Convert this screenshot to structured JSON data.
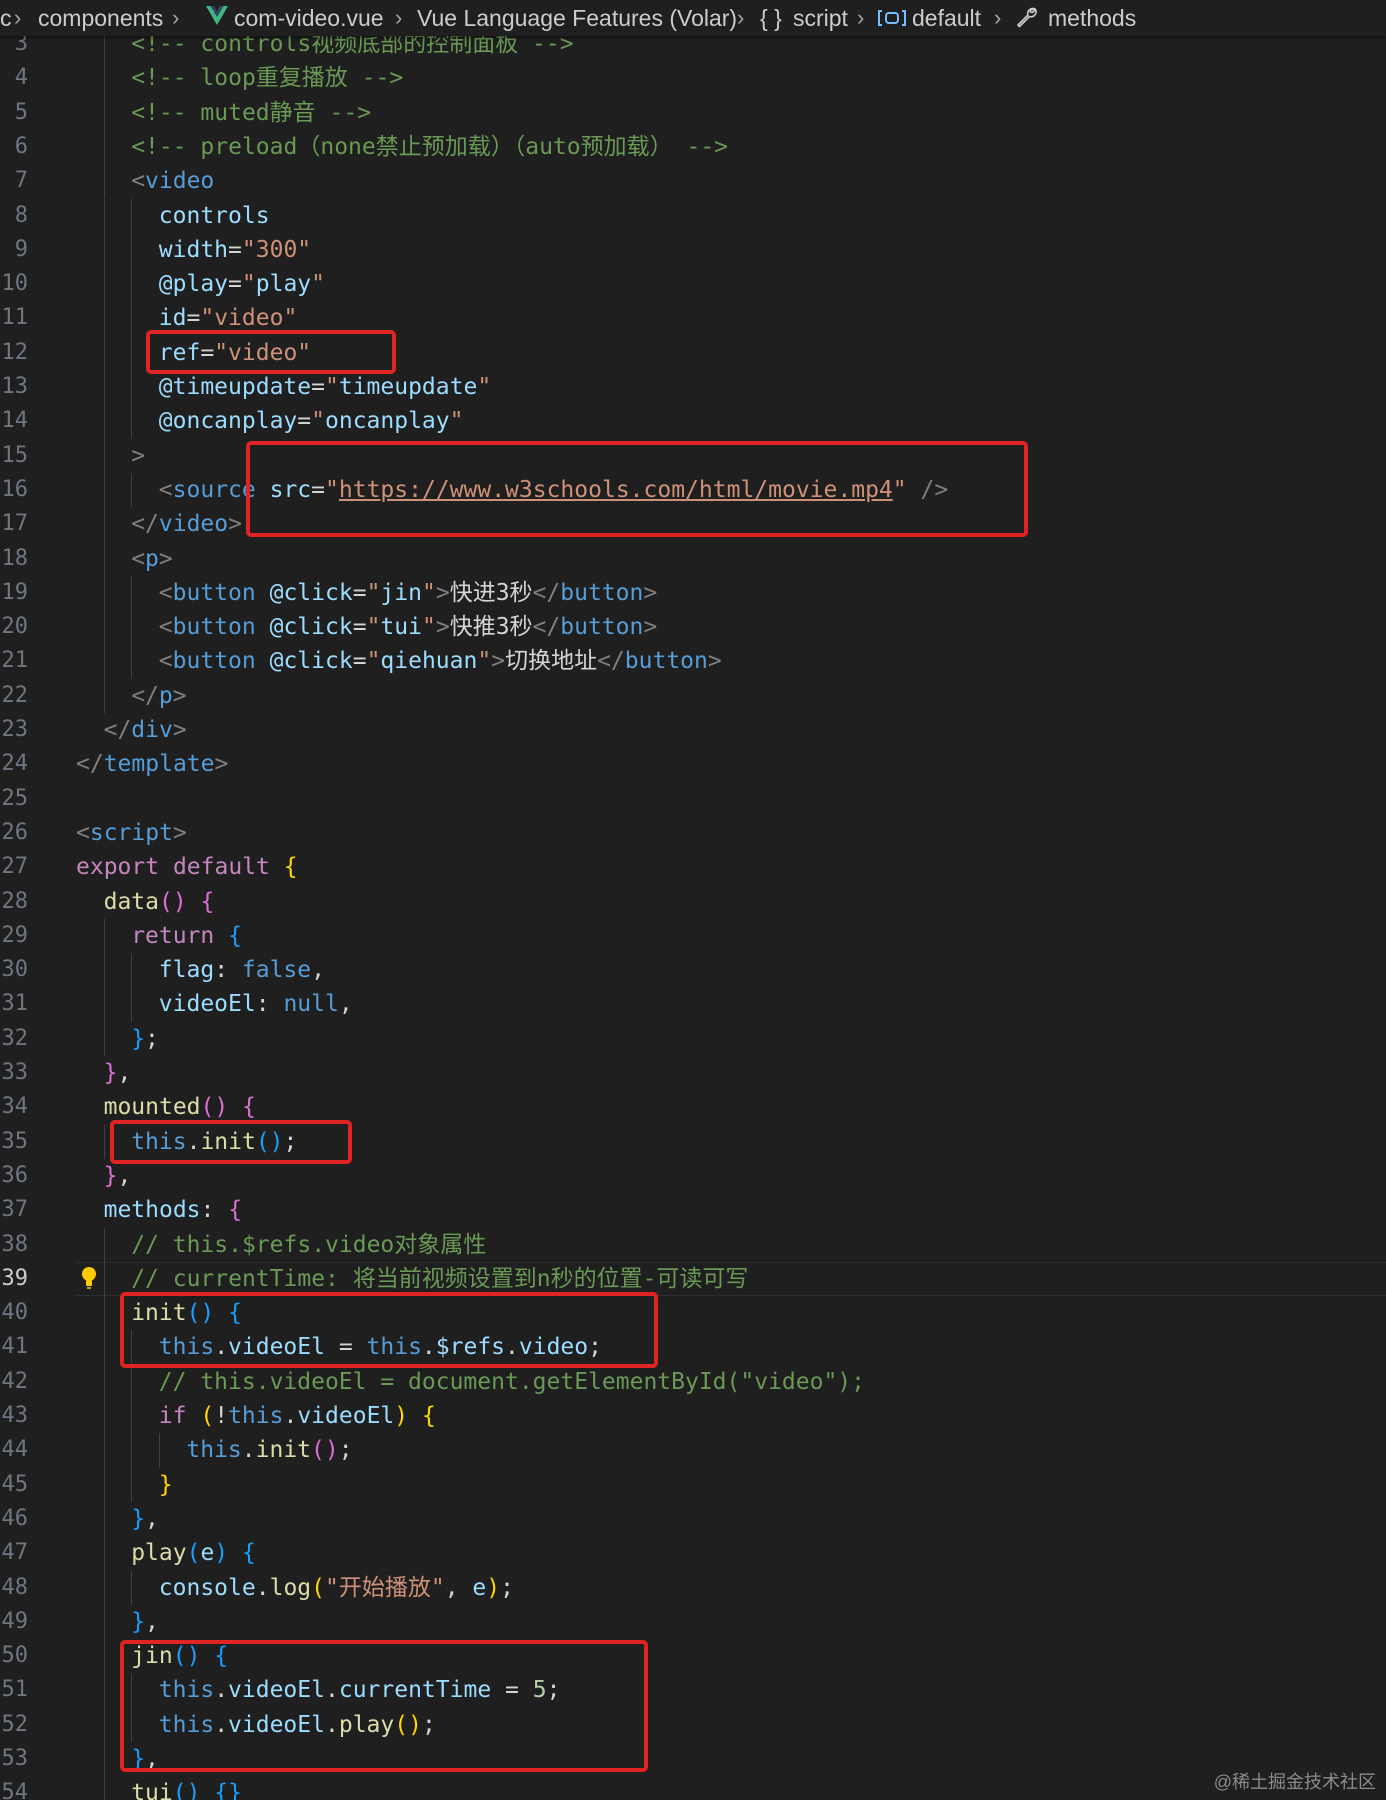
{
  "breadcrumb": {
    "items": [
      "c",
      "components",
      "com-video.vue",
      "Vue Language Features (Volar)",
      "script",
      "default",
      "methods"
    ],
    "icons": [
      "vue-icon",
      "braces-icon",
      "module-icon",
      "wrench-icon"
    ]
  },
  "editor": {
    "active_line": 39,
    "lines": [
      {
        "n": 3,
        "t": [
          [
            "c-com",
            "<!-- controls视频底部的控制面板 -->"
          ]
        ]
      },
      {
        "n": 4,
        "t": [
          [
            "c-com",
            "<!-- loop重复播放 -->"
          ]
        ]
      },
      {
        "n": 5,
        "t": [
          [
            "c-com",
            "<!-- muted静音 -->"
          ]
        ]
      },
      {
        "n": 6,
        "t": [
          [
            "c-com",
            "<!-- preload（none禁止预加载）（auto预加载） -->"
          ]
        ]
      },
      {
        "n": 7,
        "t": [
          [
            "c-br",
            "<"
          ],
          [
            "c-tag",
            "video"
          ]
        ]
      },
      {
        "n": 8,
        "t": [
          [
            "c-attr",
            "controls"
          ]
        ]
      },
      {
        "n": 9,
        "t": [
          [
            "c-attr",
            "width"
          ],
          [
            "c-txt",
            "="
          ],
          [
            "c-str",
            "\"300\""
          ]
        ]
      },
      {
        "n": 10,
        "t": [
          [
            "c-attr",
            "@play"
          ],
          [
            "c-txt",
            "="
          ],
          [
            "c-str",
            "\""
          ],
          [
            "c-var",
            "play"
          ],
          [
            "c-str",
            "\""
          ]
        ]
      },
      {
        "n": 11,
        "t": [
          [
            "c-attr",
            "id"
          ],
          [
            "c-txt",
            "="
          ],
          [
            "c-str",
            "\"video\""
          ]
        ]
      },
      {
        "n": 12,
        "t": [
          [
            "c-attr",
            "ref"
          ],
          [
            "c-txt",
            "="
          ],
          [
            "c-str",
            "\"video\""
          ]
        ]
      },
      {
        "n": 13,
        "t": [
          [
            "c-attr",
            "@timeupdate"
          ],
          [
            "c-txt",
            "="
          ],
          [
            "c-str",
            "\""
          ],
          [
            "c-var",
            "timeupdate"
          ],
          [
            "c-str",
            "\""
          ]
        ]
      },
      {
        "n": 14,
        "t": [
          [
            "c-attr",
            "@oncanplay"
          ],
          [
            "c-txt",
            "="
          ],
          [
            "c-str",
            "\""
          ],
          [
            "c-var",
            "oncanplay"
          ],
          [
            "c-str",
            "\""
          ]
        ]
      },
      {
        "n": 15,
        "t": [
          [
            "c-br",
            ">"
          ]
        ]
      },
      {
        "n": 16,
        "t": [
          [
            "c-br",
            "<"
          ],
          [
            "c-tag",
            "source"
          ],
          [
            "c-txt",
            " "
          ],
          [
            "c-attr",
            "src"
          ],
          [
            "c-txt",
            "="
          ],
          [
            "c-str",
            "\""
          ],
          [
            "c-url",
            "https://www.w3schools.com/html/movie.mp4"
          ],
          [
            "c-str",
            "\""
          ],
          [
            "c-txt",
            " "
          ],
          [
            "c-br",
            "/>"
          ]
        ]
      },
      {
        "n": 17,
        "t": [
          [
            "c-br",
            "</"
          ],
          [
            "c-tag",
            "video"
          ],
          [
            "c-br",
            ">"
          ]
        ]
      },
      {
        "n": 18,
        "t": [
          [
            "c-br",
            "<"
          ],
          [
            "c-tag",
            "p"
          ],
          [
            "c-br",
            ">"
          ]
        ]
      },
      {
        "n": 19,
        "t": [
          [
            "c-br",
            "<"
          ],
          [
            "c-tag",
            "button"
          ],
          [
            "c-txt",
            " "
          ],
          [
            "c-attr",
            "@click"
          ],
          [
            "c-txt",
            "="
          ],
          [
            "c-str",
            "\""
          ],
          [
            "c-var",
            "jin"
          ],
          [
            "c-str",
            "\""
          ],
          [
            "c-br",
            ">"
          ],
          [
            "c-txt",
            "快进3秒"
          ],
          [
            "c-br",
            "</"
          ],
          [
            "c-tag",
            "button"
          ],
          [
            "c-br",
            ">"
          ]
        ]
      },
      {
        "n": 20,
        "t": [
          [
            "c-br",
            "<"
          ],
          [
            "c-tag",
            "button"
          ],
          [
            "c-txt",
            " "
          ],
          [
            "c-attr",
            "@click"
          ],
          [
            "c-txt",
            "="
          ],
          [
            "c-str",
            "\""
          ],
          [
            "c-var",
            "tui"
          ],
          [
            "c-str",
            "\""
          ],
          [
            "c-br",
            ">"
          ],
          [
            "c-txt",
            "快推3秒"
          ],
          [
            "c-br",
            "</"
          ],
          [
            "c-tag",
            "button"
          ],
          [
            "c-br",
            ">"
          ]
        ]
      },
      {
        "n": 21,
        "t": [
          [
            "c-br",
            "<"
          ],
          [
            "c-tag",
            "button"
          ],
          [
            "c-txt",
            " "
          ],
          [
            "c-attr",
            "@click"
          ],
          [
            "c-txt",
            "="
          ],
          [
            "c-str",
            "\""
          ],
          [
            "c-var",
            "qiehuan"
          ],
          [
            "c-str",
            "\""
          ],
          [
            "c-br",
            ">"
          ],
          [
            "c-txt",
            "切换地址"
          ],
          [
            "c-br",
            "</"
          ],
          [
            "c-tag",
            "button"
          ],
          [
            "c-br",
            ">"
          ]
        ]
      },
      {
        "n": 22,
        "t": [
          [
            "c-br",
            "</"
          ],
          [
            "c-tag",
            "p"
          ],
          [
            "c-br",
            ">"
          ]
        ]
      },
      {
        "n": 23,
        "t": [
          [
            "c-br",
            "</"
          ],
          [
            "c-tag",
            "div"
          ],
          [
            "c-br",
            ">"
          ]
        ]
      },
      {
        "n": 24,
        "t": [
          [
            "c-br",
            "</"
          ],
          [
            "c-tag",
            "template"
          ],
          [
            "c-br",
            ">"
          ]
        ]
      },
      {
        "n": 25,
        "t": []
      },
      {
        "n": 26,
        "t": [
          [
            "c-br",
            "<"
          ],
          [
            "c-tag",
            "script"
          ],
          [
            "c-br",
            ">"
          ]
        ]
      },
      {
        "n": 27,
        "t": [
          [
            "c-kw",
            "export"
          ],
          [
            "c-txt",
            " "
          ],
          [
            "c-kw",
            "default"
          ],
          [
            "c-txt",
            " "
          ],
          [
            "c-b1",
            "{"
          ]
        ]
      },
      {
        "n": 28,
        "t": [
          [
            "c-fn",
            "data"
          ],
          [
            "c-b2",
            "()"
          ],
          [
            "c-txt",
            " "
          ],
          [
            "c-b2",
            "{"
          ]
        ]
      },
      {
        "n": 29,
        "t": [
          [
            "c-kw",
            "return"
          ],
          [
            "c-txt",
            " "
          ],
          [
            "c-b3",
            "{"
          ]
        ]
      },
      {
        "n": 30,
        "t": [
          [
            "c-var",
            "flag"
          ],
          [
            "c-txt",
            ": "
          ],
          [
            "c-this",
            "false"
          ],
          [
            "c-txt",
            ","
          ]
        ]
      },
      {
        "n": 31,
        "t": [
          [
            "c-var",
            "videoEl"
          ],
          [
            "c-txt",
            ": "
          ],
          [
            "c-this",
            "null"
          ],
          [
            "c-txt",
            ","
          ]
        ]
      },
      {
        "n": 32,
        "t": [
          [
            "c-b3",
            "}"
          ],
          [
            "c-txt",
            ";"
          ]
        ]
      },
      {
        "n": 33,
        "t": [
          [
            "c-b2",
            "}"
          ],
          [
            "c-txt",
            ","
          ]
        ]
      },
      {
        "n": 34,
        "t": [
          [
            "c-fn",
            "mounted"
          ],
          [
            "c-b2",
            "()"
          ],
          [
            "c-txt",
            " "
          ],
          [
            "c-b2",
            "{"
          ]
        ]
      },
      {
        "n": 35,
        "t": [
          [
            "c-this",
            "this"
          ],
          [
            "c-txt",
            "."
          ],
          [
            "c-fn",
            "init"
          ],
          [
            "c-b3",
            "()"
          ],
          [
            "c-txt",
            ";"
          ]
        ]
      },
      {
        "n": 36,
        "t": [
          [
            "c-b2",
            "}"
          ],
          [
            "c-txt",
            ","
          ]
        ]
      },
      {
        "n": 37,
        "t": [
          [
            "c-var",
            "methods"
          ],
          [
            "c-txt",
            ": "
          ],
          [
            "c-b2",
            "{"
          ]
        ]
      },
      {
        "n": 38,
        "t": [
          [
            "c-com",
            "// this.$refs.video对象属性"
          ]
        ]
      },
      {
        "n": 39,
        "t": [
          [
            "c-com",
            "// currentTime: 将当前视频设置到n秒的位置-可读可写"
          ]
        ]
      },
      {
        "n": 40,
        "t": [
          [
            "c-fn",
            "init"
          ],
          [
            "c-b3",
            "()"
          ],
          [
            "c-txt",
            " "
          ],
          [
            "c-b3",
            "{"
          ]
        ]
      },
      {
        "n": 41,
        "t": [
          [
            "c-this",
            "this"
          ],
          [
            "c-txt",
            "."
          ],
          [
            "c-var",
            "videoEl"
          ],
          [
            "c-txt",
            " = "
          ],
          [
            "c-this",
            "this"
          ],
          [
            "c-txt",
            "."
          ],
          [
            "c-var",
            "$refs"
          ],
          [
            "c-txt",
            "."
          ],
          [
            "c-var",
            "video"
          ],
          [
            "c-txt",
            ";"
          ]
        ]
      },
      {
        "n": 42,
        "t": [
          [
            "c-com",
            "// this.videoEl = document.getElementById(\"video\");"
          ]
        ]
      },
      {
        "n": 43,
        "t": [
          [
            "c-kw",
            "if"
          ],
          [
            "c-txt",
            " "
          ],
          [
            "c-b1",
            "("
          ],
          [
            "c-txt",
            "!"
          ],
          [
            "c-this",
            "this"
          ],
          [
            "c-txt",
            "."
          ],
          [
            "c-var",
            "videoEl"
          ],
          [
            "c-b1",
            ")"
          ],
          [
            "c-txt",
            " "
          ],
          [
            "c-b1",
            "{"
          ]
        ]
      },
      {
        "n": 44,
        "t": [
          [
            "c-this",
            "this"
          ],
          [
            "c-txt",
            "."
          ],
          [
            "c-fn",
            "init"
          ],
          [
            "c-b2",
            "()"
          ],
          [
            "c-txt",
            ";"
          ]
        ]
      },
      {
        "n": 45,
        "t": [
          [
            "c-b1",
            "}"
          ]
        ]
      },
      {
        "n": 46,
        "t": [
          [
            "c-b3",
            "}"
          ],
          [
            "c-txt",
            ","
          ]
        ]
      },
      {
        "n": 47,
        "t": [
          [
            "c-fn",
            "play"
          ],
          [
            "c-b3",
            "("
          ],
          [
            "c-var",
            "e"
          ],
          [
            "c-b3",
            ")"
          ],
          [
            "c-txt",
            " "
          ],
          [
            "c-b3",
            "{"
          ]
        ]
      },
      {
        "n": 48,
        "t": [
          [
            "c-var",
            "console"
          ],
          [
            "c-txt",
            "."
          ],
          [
            "c-fn",
            "log"
          ],
          [
            "c-b1",
            "("
          ],
          [
            "c-str",
            "\"开始播放\""
          ],
          [
            "c-txt",
            ", "
          ],
          [
            "c-var",
            "e"
          ],
          [
            "c-b1",
            ")"
          ],
          [
            "c-txt",
            ";"
          ]
        ]
      },
      {
        "n": 49,
        "t": [
          [
            "c-b3",
            "}"
          ],
          [
            "c-txt",
            ","
          ]
        ]
      },
      {
        "n": 50,
        "t": [
          [
            "c-fn",
            "jin"
          ],
          [
            "c-b3",
            "()"
          ],
          [
            "c-txt",
            " "
          ],
          [
            "c-b3",
            "{"
          ]
        ]
      },
      {
        "n": 51,
        "t": [
          [
            "c-this",
            "this"
          ],
          [
            "c-txt",
            "."
          ],
          [
            "c-var",
            "videoEl"
          ],
          [
            "c-txt",
            "."
          ],
          [
            "c-var",
            "currentTime"
          ],
          [
            "c-txt",
            " = "
          ],
          [
            "c-num",
            "5"
          ],
          [
            "c-txt",
            ";"
          ]
        ]
      },
      {
        "n": 52,
        "t": [
          [
            "c-this",
            "this"
          ],
          [
            "c-txt",
            "."
          ],
          [
            "c-var",
            "videoEl"
          ],
          [
            "c-txt",
            "."
          ],
          [
            "c-fn",
            "play"
          ],
          [
            "c-b1",
            "()"
          ],
          [
            "c-txt",
            ";"
          ]
        ]
      },
      {
        "n": 53,
        "t": [
          [
            "c-b3",
            "}"
          ],
          [
            "c-txt",
            ","
          ]
        ]
      },
      {
        "n": 54,
        "t": [
          [
            "c-fn",
            "tui"
          ],
          [
            "c-b3",
            "()"
          ],
          [
            "c-txt",
            " "
          ],
          [
            "c-b3",
            "{}"
          ]
        ]
      }
    ]
  },
  "watermark": "@稀土掘金技术社区"
}
